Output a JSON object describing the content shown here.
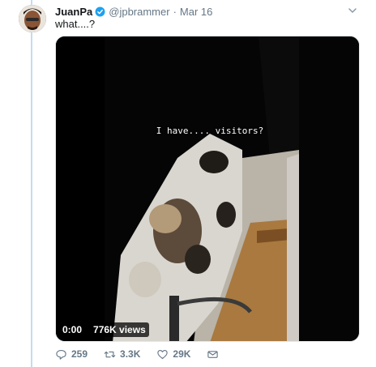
{
  "tweet": {
    "display_name": "JuanPa",
    "handle": "@jpbrammer",
    "separator": "·",
    "date": "Mar 16",
    "text": "what....?"
  },
  "video": {
    "caption": "I have.... visitors?",
    "time": "0:00",
    "views": "776K views"
  },
  "actions": {
    "replies": "259",
    "retweets": "3.3K",
    "likes": "29K"
  },
  "icons": {
    "verified": "verified-badge-icon",
    "caret": "chevron-down-icon",
    "reply": "reply-icon",
    "retweet": "retweet-icon",
    "like": "heart-icon",
    "dm": "envelope-icon"
  },
  "colors": {
    "verified": "#1da1f2",
    "thread_line": "#c4dbef",
    "secondary_text": "#657786"
  }
}
